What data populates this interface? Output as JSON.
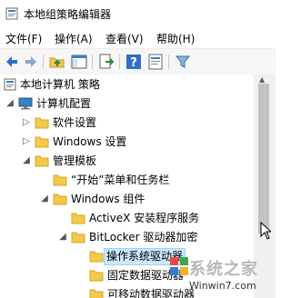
{
  "window": {
    "title": "本地组策略编辑器"
  },
  "menubar": {
    "items": [
      {
        "label": "文件(F)"
      },
      {
        "label": "操作(A)"
      },
      {
        "label": "查看(V)"
      },
      {
        "label": "帮助(H)"
      }
    ]
  },
  "toolbar": {
    "buttons": [
      "back-icon",
      "forward-icon",
      "up-folder-icon",
      "show-hide-tree-icon",
      "export-list-icon",
      "help-icon",
      "properties-icon",
      "filter-icon"
    ]
  },
  "tree": {
    "items": [
      {
        "label": "本地计算机 策略",
        "icon": "policy-icon",
        "expanded": true,
        "level": 0
      },
      {
        "label": "计算机配置",
        "icon": "computer-icon",
        "expanded": true,
        "level": 1
      },
      {
        "label": "软件设置",
        "icon": "folder-icon",
        "expanded": false,
        "level": 2
      },
      {
        "label": "Windows 设置",
        "icon": "folder-icon",
        "expanded": false,
        "level": 2
      },
      {
        "label": "管理模板",
        "icon": "folder-icon",
        "expanded": true,
        "level": 2
      },
      {
        "label": "“开始”菜单和任务栏",
        "icon": "folder-icon",
        "expanded": null,
        "level": 3
      },
      {
        "label": "Windows 组件",
        "icon": "folder-icon",
        "expanded": true,
        "level": 3
      },
      {
        "label": "ActiveX 安装程序服务",
        "icon": "folder-icon",
        "expanded": null,
        "level": 4
      },
      {
        "label": "BitLocker 驱动器加密",
        "icon": "folder-icon",
        "expanded": true,
        "level": 4
      },
      {
        "label": "操作系统驱动器",
        "icon": "folder-icon",
        "expanded": null,
        "level": 5,
        "selected": true
      },
      {
        "label": "固定数据驱动器",
        "icon": "folder-icon",
        "expanded": null,
        "level": 5
      },
      {
        "label": "可移动数据驱动器",
        "icon": "folder-icon",
        "expanded": null,
        "level": 5
      }
    ]
  },
  "watermark": {
    "text": "系统之家",
    "url": "Winwin7.com"
  },
  "colors": {
    "folder": "#f2c94c",
    "folder_dark": "#d9a520",
    "selection": "#cce8ff",
    "selection_border": "#99d1ff"
  }
}
